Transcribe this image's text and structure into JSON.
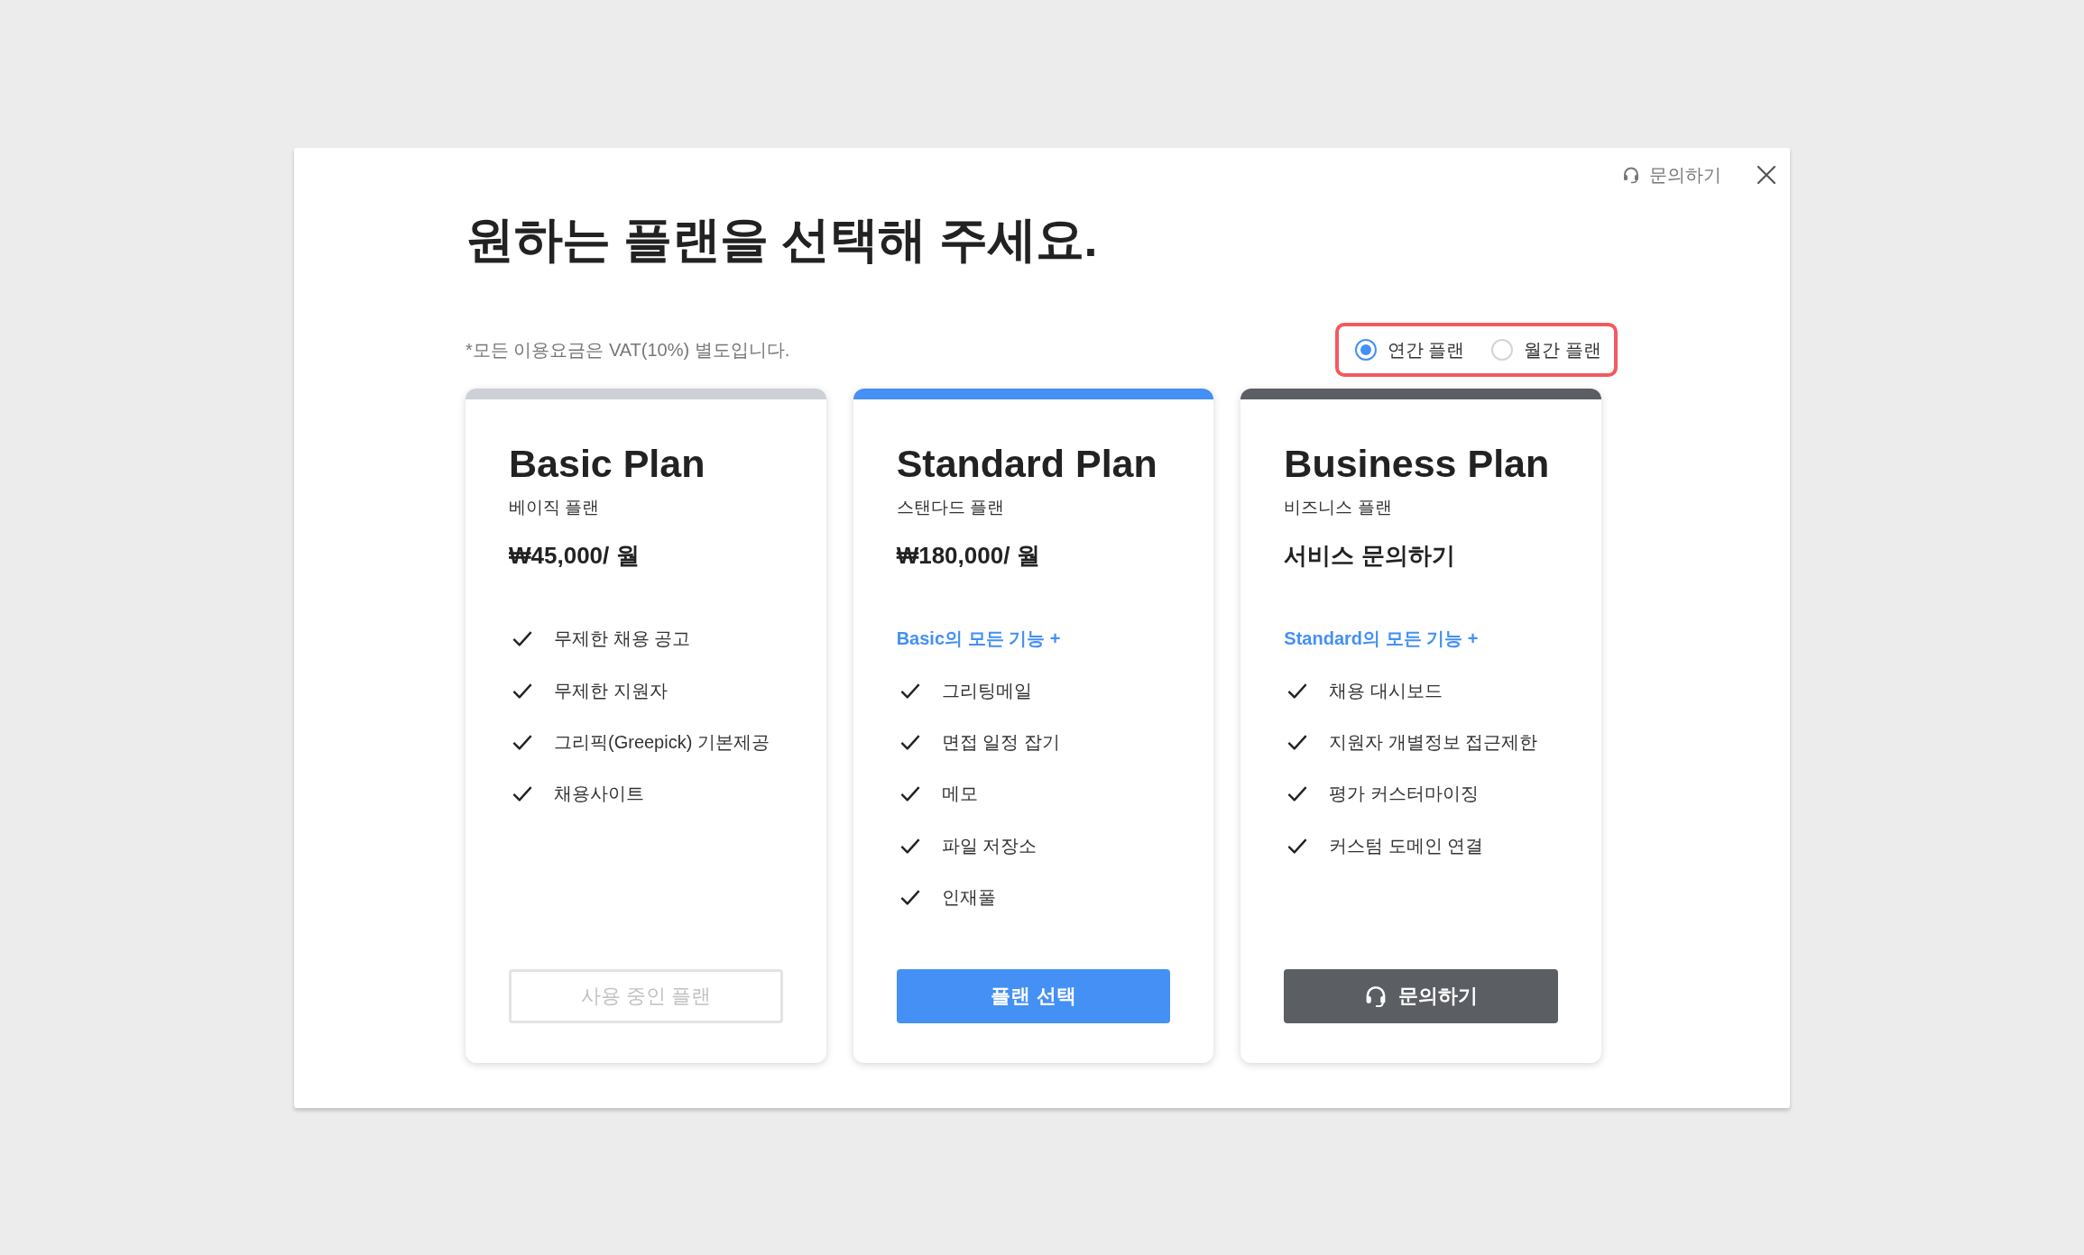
{
  "header": {
    "help_link": "문의하기"
  },
  "title": "원하는 플랜을 선택해 주세요.",
  "vat_note": "*모든 이용요금은 VAT(10%) 별도입니다.",
  "billing_options": [
    {
      "label": "연간 플랜",
      "selected": true
    },
    {
      "label": "월간 플랜",
      "selected": false
    }
  ],
  "plans": [
    {
      "name": "Basic Plan",
      "subtitle": "베이직 플랜",
      "price": "₩45,000/ 월",
      "color": "#cdd0d4",
      "features": [
        "무제한 채용 공고",
        "무제한 지원자",
        "그리픽(Greepick) 기본제공",
        "채용사이트"
      ],
      "button": {
        "kind": "current",
        "label": "사용 중인 플랜"
      }
    },
    {
      "name": "Standard Plan",
      "subtitle": "스탠다드 플랜",
      "price": "₩180,000/ 월",
      "color": "#4490f5",
      "includes": "Basic의 모든 기능 +",
      "features": [
        "그리팅메일",
        "면접 일정 잡기",
        "메모",
        "파일 저장소",
        "인재풀"
      ],
      "button": {
        "kind": "select",
        "label": "플랜 선택"
      }
    },
    {
      "name": "Business Plan",
      "subtitle": "비즈니스 플랜",
      "price": "서비스 문의하기",
      "color": "#5b5e63",
      "includes": "Standard의 모든 기능 +",
      "features": [
        "채용 대시보드",
        "지원자 개별정보 접근제한",
        "평가 커스터마이징",
        "커스텀 도메인 연결"
      ],
      "button": {
        "kind": "contact",
        "label": "문의하기"
      }
    }
  ]
}
